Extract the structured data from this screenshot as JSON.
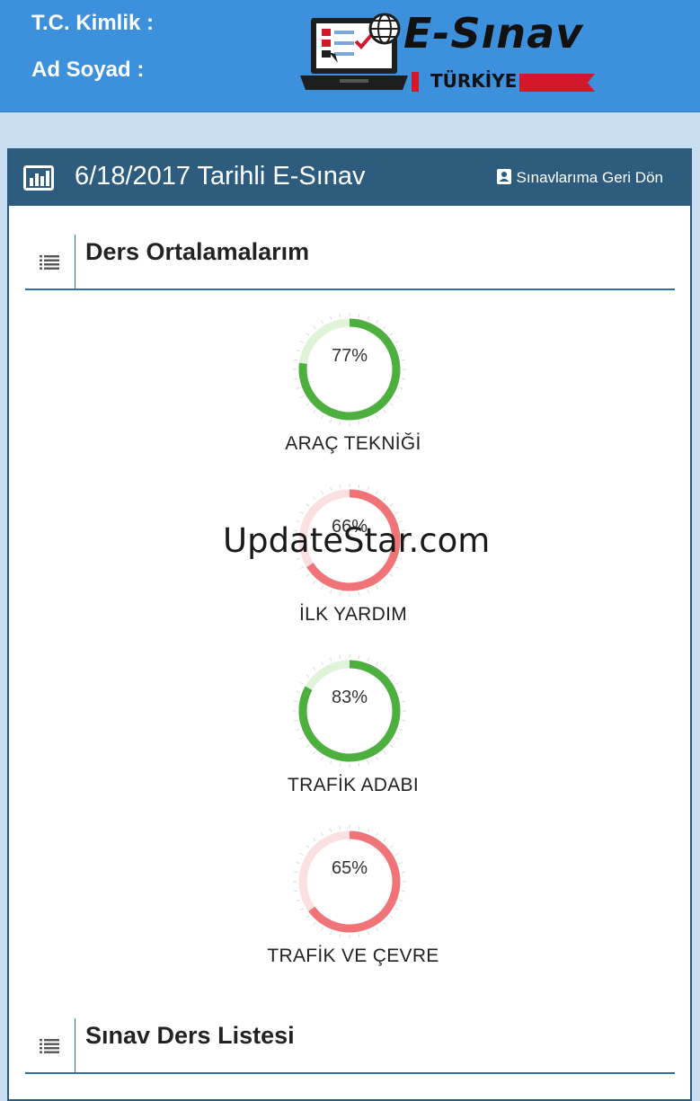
{
  "header": {
    "tc_label": "T.C. Kimlik :",
    "name_label": "Ad Soyad  :",
    "logo_title": "E-Sınav",
    "logo_subtitle": "TÜRKİYE",
    "colors": {
      "background": "#3d90dc",
      "logo_accent": "#d3182b"
    }
  },
  "panel": {
    "title": "6/18/2017 Tarihli E-Sınav",
    "title_icon": "bar-chart-icon",
    "back_label": "Sınavlarıma Geri Dön",
    "back_icon": "contact-card-icon",
    "header_color": "#2e5c7e"
  },
  "averages": {
    "title": "Ders Ortalamalarım",
    "icon": "list-icon",
    "gauges": [
      {
        "percent_text": "77%",
        "value": 77,
        "label": "ARAÇ TEKNİĞİ",
        "color": "#4caf3e",
        "track": "#dff3d9"
      },
      {
        "percent_text": "66%",
        "value": 66,
        "label": "İLK YARDIM",
        "color": "#f07377",
        "track": "#fbe0e1"
      },
      {
        "percent_text": "83%",
        "value": 83,
        "label": "TRAFİK ADABI",
        "color": "#4caf3e",
        "track": "#dff3d9"
      },
      {
        "percent_text": "65%",
        "value": 65,
        "label": "TRAFİK VE ÇEVRE",
        "color": "#f07377",
        "track": "#fbe0e1"
      }
    ]
  },
  "course_list": {
    "title": "Sınav Ders Listesi",
    "icon": "list-icon"
  },
  "watermark": "UpdateStar.com"
}
